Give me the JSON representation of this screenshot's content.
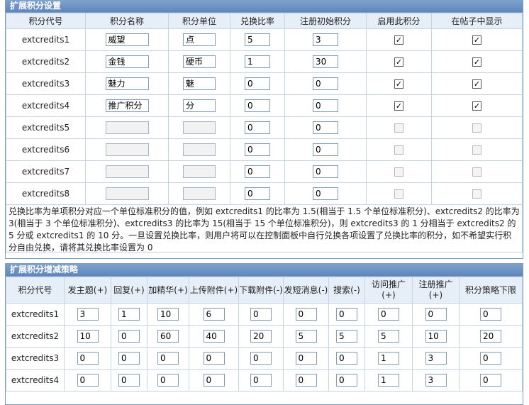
{
  "panel1": {
    "title": "扩展积分设置",
    "headers": [
      "积分代号",
      "积分名称",
      "积分单位",
      "兑换比率",
      "注册初始积分",
      "启用此积分",
      "在帖子中显示"
    ],
    "rows": [
      {
        "code": "extcredits1",
        "name": "威望",
        "unit": "点",
        "ratio": "5",
        "init": "3",
        "enabled": true,
        "show": true
      },
      {
        "code": "extcredits2",
        "name": "金钱",
        "unit": "硬币",
        "ratio": "1",
        "init": "30",
        "enabled": true,
        "show": true
      },
      {
        "code": "extcredits3",
        "name": "魅力",
        "unit": "魅",
        "ratio": "0",
        "init": "0",
        "enabled": true,
        "show": true
      },
      {
        "code": "extcredits4",
        "name": "推广积分",
        "unit": "分",
        "ratio": "0",
        "init": "0",
        "enabled": true,
        "show": true
      },
      {
        "code": "extcredits5",
        "name": "",
        "unit": "",
        "ratio": "0",
        "init": "0",
        "enabled": false,
        "show": false
      },
      {
        "code": "extcredits6",
        "name": "",
        "unit": "",
        "ratio": "0",
        "init": "0",
        "enabled": false,
        "show": false
      },
      {
        "code": "extcredits7",
        "name": "",
        "unit": "",
        "ratio": "0",
        "init": "0",
        "enabled": false,
        "show": false
      },
      {
        "code": "extcredits8",
        "name": "",
        "unit": "",
        "ratio": "0",
        "init": "0",
        "enabled": false,
        "show": false
      }
    ],
    "note": "兑换比率为单项积分对应一个单位标准积分的值，例如 extcredits1 的比率为 1.5(相当于 1.5 个单位标准积分)、extcredits2 的比率为 3(相当于 3 个单位标准积分)、extcredits3 的比率为 15(相当于 15 个单位标准积分)，则 extcredits3 的 1 分相当于 extcredits2 的 5 分或 extcredits1 的 10 分。一旦设置兑换比率，则用户将可以在控制面板中自行兑换各项设置了兑换比率的积分，如不希望实行积分自由兑换，请将其兑换比率设置为 0"
  },
  "panel2": {
    "title": "扩展积分增减策略",
    "headers": [
      "积分代号",
      "发主题(+)",
      "回复(+)",
      "加精华(+)",
      "上传附件(+)",
      "下载附件(-)",
      "发短消息(-)",
      "搜索(-)",
      "访问推广(+)",
      "注册推广(+)",
      "积分策略下限"
    ],
    "rows": [
      {
        "code": "extcredits1",
        "values": [
          "3",
          "1",
          "10",
          "6",
          "0",
          "0",
          "0",
          "0",
          "0",
          "0"
        ]
      },
      {
        "code": "extcredits2",
        "values": [
          "10",
          "0",
          "60",
          "40",
          "20",
          "5",
          "5",
          "5",
          "10",
          "20"
        ]
      },
      {
        "code": "extcredits3",
        "values": [
          "0",
          "0",
          "0",
          "0",
          "0",
          "0",
          "0",
          "1",
          "3",
          "0"
        ]
      },
      {
        "code": "extcredits4",
        "values": [
          "0",
          "0",
          "0",
          "0",
          "0",
          "0",
          "0",
          "1",
          "3",
          "0"
        ]
      }
    ]
  }
}
